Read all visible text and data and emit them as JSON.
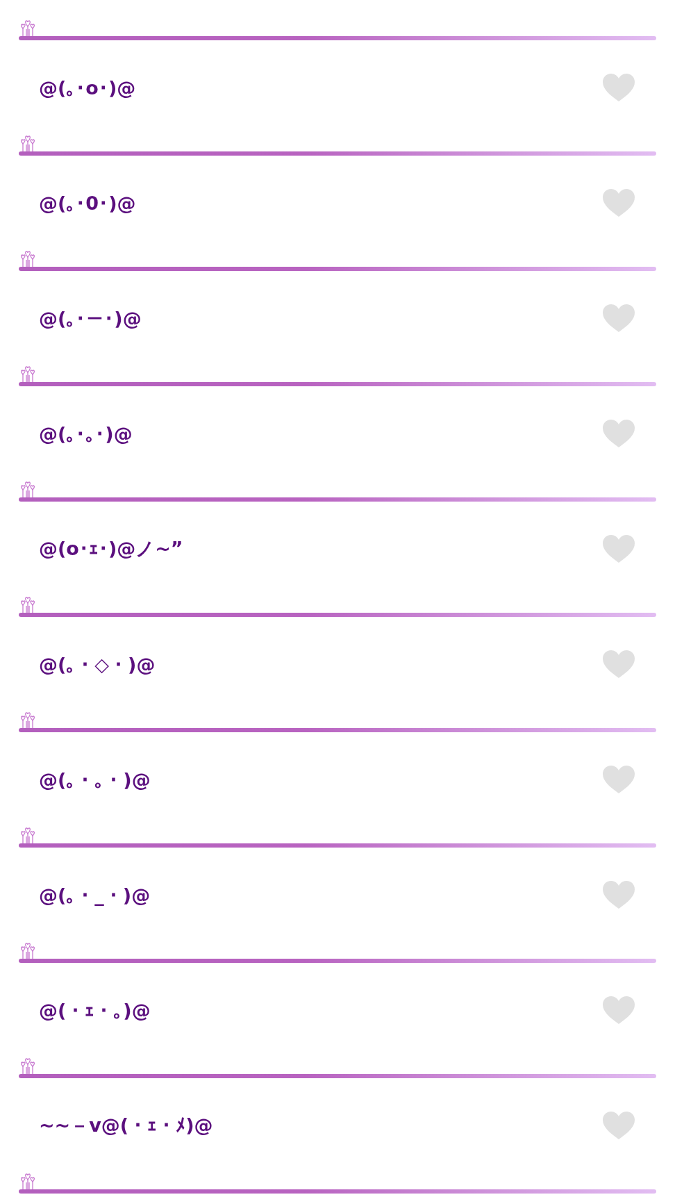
{
  "items": [
    {
      "text": "@(｡･o･)@",
      "favorited": false
    },
    {
      "text": "@(｡･0･)@",
      "favorited": false
    },
    {
      "text": "@(｡･－･)@",
      "favorited": false
    },
    {
      "text": "@(｡･｡･)@",
      "favorited": false
    },
    {
      "text": "@(o･ｪ･)@ノ~”",
      "favorited": false
    },
    {
      "text": "@(｡・◇・)@",
      "favorited": false
    },
    {
      "text": "@(｡・｡・)@",
      "favorited": false
    },
    {
      "text": "@(｡・_・)@",
      "favorited": false
    },
    {
      "text": "@(・ｪ・｡)@",
      "favorited": false
    },
    {
      "text": "~~－v@(・ｪ・ﾒ)@",
      "favorited": false
    }
  ]
}
